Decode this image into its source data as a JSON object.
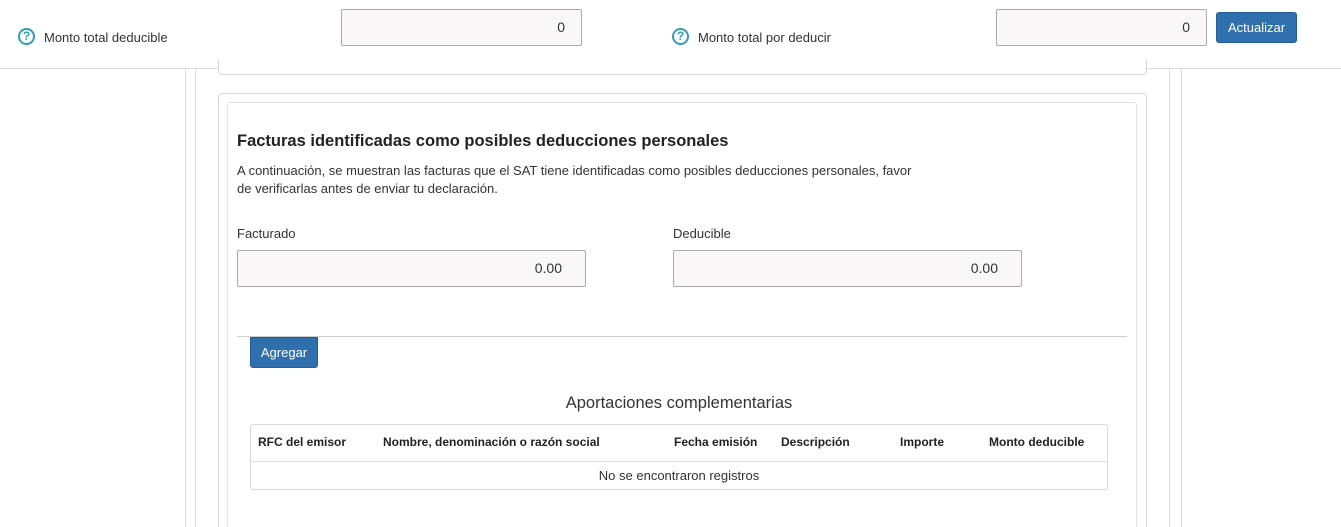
{
  "top_bar": {
    "deducible_label": "Monto total deducible",
    "deducible_value": "0",
    "por_deducir_label": "Monto total por deducir",
    "por_deducir_value": "0",
    "update_button": "Actualizar",
    "help_glyph": "?"
  },
  "section": {
    "title": "Facturas identificadas como posibles deducciones personales",
    "description_line1": "A continuación, se muestran las facturas que el SAT tiene identificadas como posibles deducciones personales, favor",
    "description_line2": "de verificarlas antes de enviar tu declaración.",
    "facturado_label": "Facturado",
    "facturado_value": "0.00",
    "deducible_label": "Deducible",
    "deducible_value": "0.00",
    "add_button": "Agregar"
  },
  "table": {
    "caption": "Aportaciones complementarias",
    "columns": [
      "RFC del emisor",
      "Nombre, denominación o razón social",
      "Fecha emisión",
      "Descripción",
      "Importe",
      "Monto deducible"
    ],
    "empty_message": "No se encontraron registros"
  },
  "colors": {
    "accent": "#2f6fae",
    "help_icon": "#2f9fb8"
  }
}
